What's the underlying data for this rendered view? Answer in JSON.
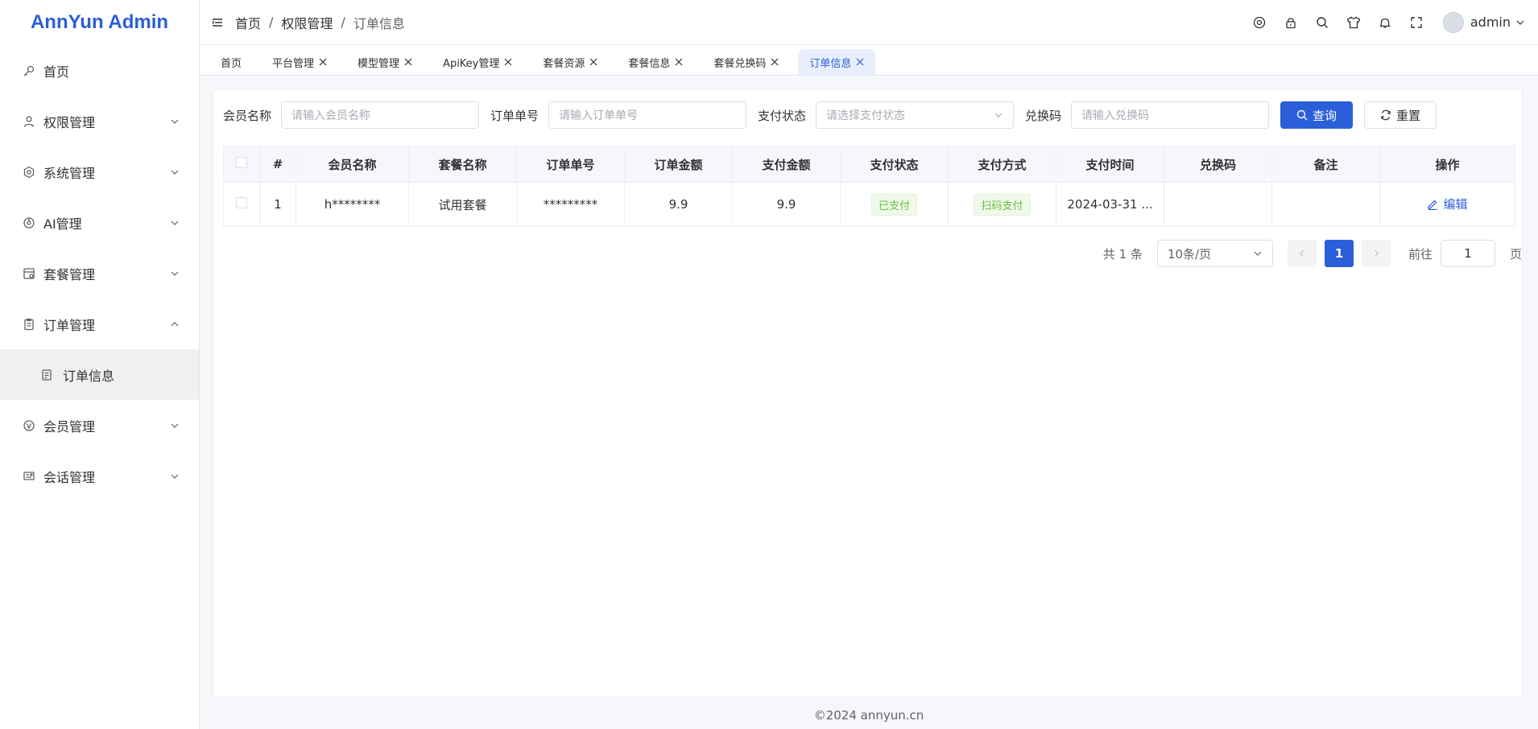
{
  "app": {
    "logo": "AnnYun Admin"
  },
  "sidebar": {
    "items": [
      {
        "label": "首页",
        "icon": "key-icon"
      },
      {
        "label": "权限管理",
        "icon": "user-icon"
      },
      {
        "label": "系统管理",
        "icon": "settings-icon"
      },
      {
        "label": "AI管理",
        "icon": "ai-icon"
      },
      {
        "label": "套餐管理",
        "icon": "package-icon"
      },
      {
        "label": "订单管理",
        "icon": "clipboard-icon"
      },
      {
        "label": "会员管理",
        "icon": "vip-icon"
      },
      {
        "label": "会话管理",
        "icon": "chat-icon"
      }
    ],
    "sub_item": {
      "label": "订单信息",
      "icon": "document-icon"
    }
  },
  "header": {
    "breadcrumb": [
      "首页",
      "权限管理",
      "订单信息"
    ],
    "separator": "/",
    "username": "admin"
  },
  "tabs": [
    "首页",
    "平台管理",
    "模型管理",
    "ApiKey管理",
    "套餐资源",
    "套餐信息",
    "套餐兑换码",
    "订单信息"
  ],
  "filters": {
    "member_label": "会员名称",
    "member_placeholder": "请输入会员名称",
    "order_label": "订单单号",
    "order_placeholder": "请输入订单单号",
    "status_label": "支付状态",
    "status_placeholder": "请选择支付状态",
    "code_label": "兑换码",
    "code_placeholder": "请输入兑换码",
    "search_btn": "查询",
    "reset_btn": "重置"
  },
  "table": {
    "columns": [
      "#",
      "会员名称",
      "套餐名称",
      "订单单号",
      "订单金额",
      "支付金额",
      "支付状态",
      "支付方式",
      "支付时间",
      "兑换码",
      "备注",
      "操作"
    ],
    "rows": [
      {
        "index": "1",
        "member": "h********",
        "package": "试用套餐",
        "order_no": "*********",
        "order_amount": "9.9",
        "pay_amount": "9.9",
        "status": "已支付",
        "method": "扫码支付",
        "pay_time": "2024-03-31 ...",
        "code": "",
        "remark": "",
        "action": "编辑"
      }
    ]
  },
  "pagination": {
    "total": "共 1 条",
    "page_size": "10条/页",
    "current": "1",
    "goto_label": "前往",
    "goto_value": "1",
    "page_suffix": "页"
  },
  "footer": "©2024 annyun.cn",
  "colors": {
    "primary": "#2b5fd9",
    "success": "#67c23a"
  }
}
